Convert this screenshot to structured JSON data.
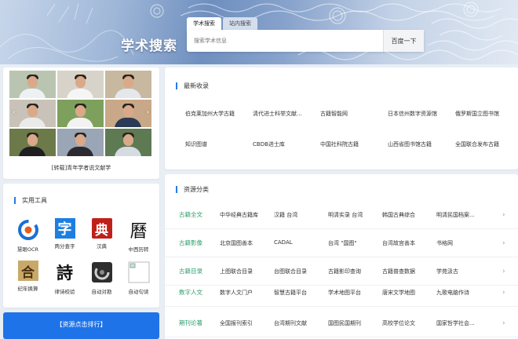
{
  "header": {
    "site_title": "学术搜索",
    "tabs": [
      {
        "label": "学术搜索"
      },
      {
        "label": "站内搜索"
      }
    ],
    "search": {
      "placeholder": "搜索学术信息",
      "button": "百度一下"
    }
  },
  "carousel": {
    "caption": "[转载]青年学者说文献学",
    "prev_icon": "chevron-left-icon",
    "next_icon": "chevron-right-icon"
  },
  "tools": {
    "title": "实用工具",
    "items": [
      {
        "label": "慧眼OCR",
        "icon": "ocr-eye-icon",
        "color": "#1b6fd6"
      },
      {
        "label": "两分查字",
        "icon": "character-icon",
        "glyph": "字",
        "color": "#1d7fe0"
      },
      {
        "label": "汉典",
        "icon": "seal-icon",
        "glyph": "典",
        "color": "#c0201a"
      },
      {
        "label": "中西历转",
        "icon": "calendar-icon",
        "glyph": "曆",
        "color": "#111111"
      },
      {
        "label": "纪年换算",
        "icon": "year-convert-icon",
        "glyph": "合",
        "color": "#7a5a2e"
      },
      {
        "label": "律诗校验",
        "icon": "poem-icon",
        "glyph": "詩",
        "color": "#111111"
      },
      {
        "label": "自动对勘",
        "icon": "collate-icon",
        "color": "#3a3a3a"
      },
      {
        "label": "自动句读",
        "icon": "broken-image-icon",
        "color": "#999999"
      }
    ]
  },
  "rank_button": "【资源点击排行】",
  "latest": {
    "title": "最新收录",
    "items": [
      "伯克莱加州大学古籍",
      "清代进士科举文献...",
      "古籍智能网",
      "日本信州数字资源馆",
      "俄罗斯国立图书馆",
      "知识图谱",
      "CBDB进士库",
      "中国社科院古籍",
      "山西省图书馆古籍",
      "全国联合发布古籍"
    ]
  },
  "resources": {
    "title": "资源分类",
    "rows": [
      {
        "category": "古籍全文",
        "items": [
          "中华经典古籍库",
          "汉籍 台湾",
          "明清实录 台湾",
          "韩国古典综合",
          "明清民国档案..."
        ]
      },
      {
        "category": "古籍影像",
        "items": [
          "北京国图善本",
          "CADAL",
          "台湾 \"国图\"",
          "台湾故宫善本",
          "书格网"
        ]
      },
      {
        "category": "古籍目录",
        "items": [
          "上图联合目录",
          "台图联合目录",
          "古籍影印查询",
          "古籍普查数据",
          "学苑汲古"
        ]
      },
      {
        "category": "数字人文",
        "items": [
          "数字人文门户",
          "智慧古籍平台",
          "学术地图平台",
          "唐宋文学地图",
          "九歌电脑作诗"
        ]
      },
      {
        "category": "期刊论著",
        "items": [
          "全国报刊索引",
          "台湾期刊文献",
          "国图民国期刊",
          "高校学位论文",
          "国家哲学社会..."
        ]
      }
    ]
  },
  "colors": {
    "accent": "#1f73e8",
    "category_green": "#2b9e6a",
    "heading_bar": "#2a7ae4"
  }
}
